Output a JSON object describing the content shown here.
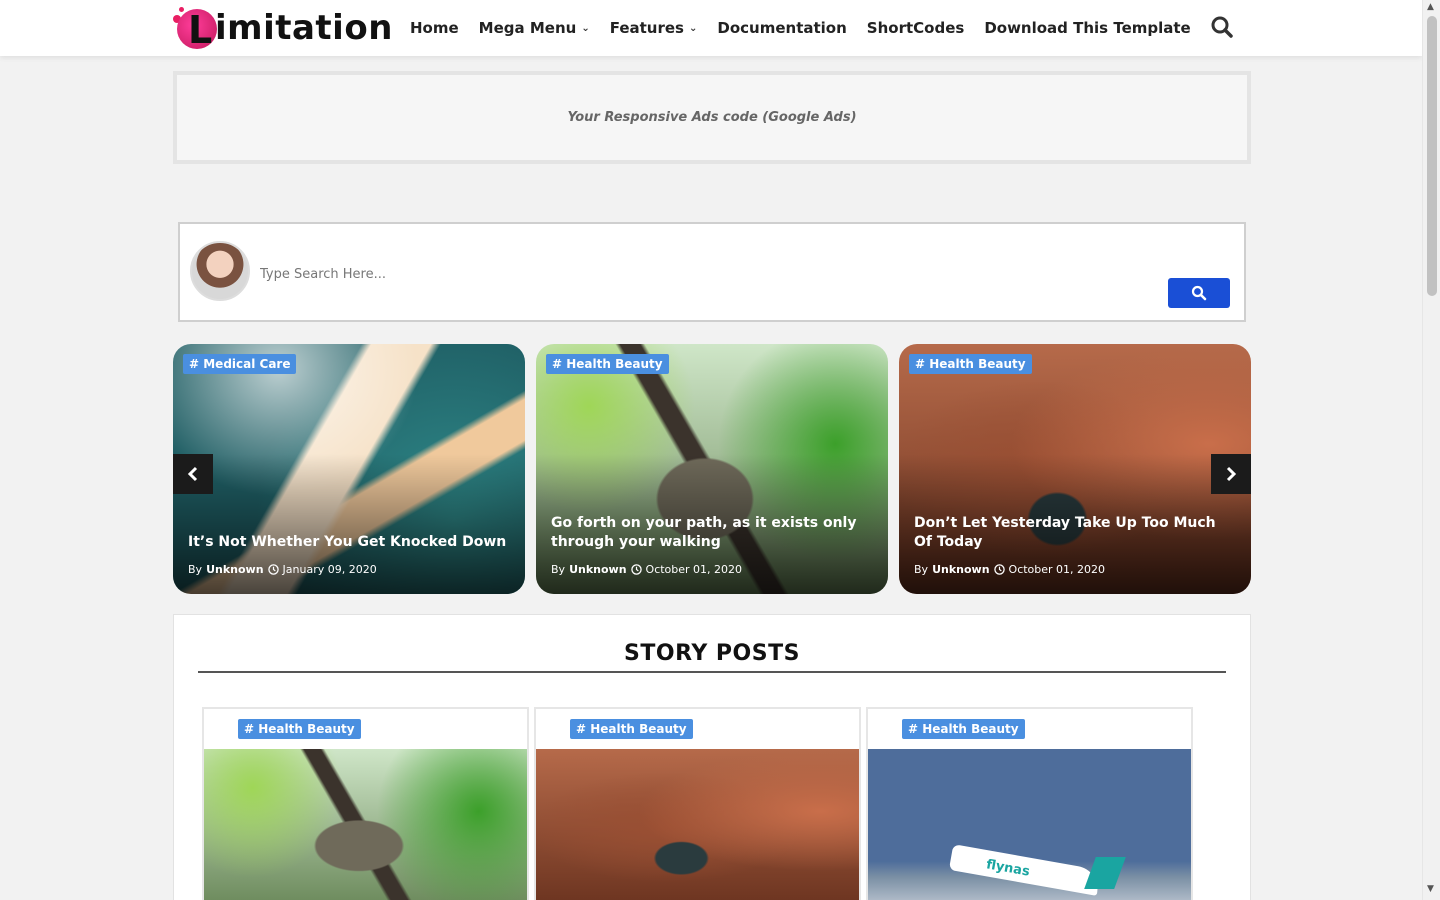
{
  "header": {
    "logo_letter": "L",
    "logo_text": "imitation",
    "nav": [
      {
        "label": "Home"
      },
      {
        "label": "Mega Menu",
        "has_dropdown": true
      },
      {
        "label": "Features",
        "has_dropdown": true
      },
      {
        "label": "Documentation"
      },
      {
        "label": "ShortCodes"
      },
      {
        "label": "Download This Template"
      }
    ],
    "search_icon": "search-icon"
  },
  "ads": {
    "text": "Your Responsive Ads code (Google Ads)"
  },
  "search": {
    "placeholder": "Type Search Here...",
    "button_icon": "search-icon"
  },
  "slider": {
    "slides": [
      {
        "tag": "# Medical Care",
        "title": "It’s Not Whether You Get Knocked Down",
        "by": "By",
        "author": "Unknown",
        "date": "January 09, 2020",
        "image": "snake"
      },
      {
        "tag": "# Health Beauty",
        "title": "Go forth on your path, as it exists only through your walking",
        "by": "By",
        "author": "Unknown",
        "date": "October 01, 2020",
        "image": "squirrel"
      },
      {
        "tag": "# Health Beauty",
        "title": "Don’t Let Yesterday Take Up Too Much Of Today",
        "by": "By",
        "author": "Unknown",
        "date": "October 01, 2020",
        "image": "canyon"
      }
    ],
    "prev_icon": "chevron-left-icon",
    "next_icon": "chevron-right-icon"
  },
  "stories": {
    "title": "STORY POSTS",
    "cards": [
      {
        "tag": "# Health Beauty",
        "image": "squirrel"
      },
      {
        "tag": "# Health Beauty",
        "image": "canyon"
      },
      {
        "tag": "# Health Beauty",
        "image": "plane",
        "brand_text": "flynas"
      }
    ]
  },
  "colors": {
    "accent": "#1a4fd6",
    "tag": "#4a8fe0",
    "logo_pink": "#e91e63"
  }
}
